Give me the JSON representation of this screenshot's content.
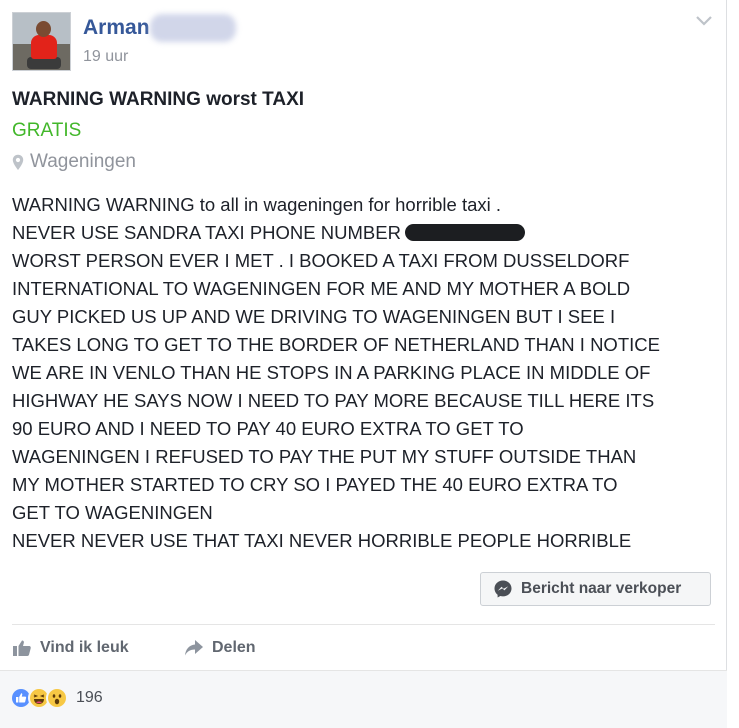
{
  "post": {
    "author": "Arman",
    "timestamp": "19 uur",
    "title": "WARNING WARNING worst TAXI",
    "price": "GRATIS",
    "location": "Wageningen",
    "description_lines": [
      "WARNING WARNING to all in wageningen for horrible taxi .",
      "NEVER USE SANDRA TAXI PHONE NUMBER",
      "WORST PERSON EVER I MET . I BOOKED A TAXI FROM DUSSELDORF",
      "INTERNATIONAL TO WAGENINGEN FOR ME AND MY MOTHER A BOLD",
      "GUY PICKED US UP AND WE DRIVING TO WAGENINGEN BUT I SEE I",
      "TAKES LONG TO GET TO THE BORDER OF NETHERLAND THAN I NOTICE",
      "WE ARE IN VENLO THAN HE STOPS IN A PARKING PLACE IN MIDDLE OF",
      "HIGHWAY HE SAYS NOW I NEED TO PAY MORE BECAUSE TILL HERE ITS",
      "90 EURO AND I NEED TO PAY 40 EURO EXTRA TO GET TO",
      "WAGENINGEN I REFUSED TO PAY THE PUT MY STUFF OUTSIDE THAN",
      "MY MOTHER STARTED TO CRY SO I PAYED THE 40 EURO EXTRA TO",
      "GET TO WAGENINGEN",
      "NEVER NEVER USE THAT TAXI NEVER HORRIBLE PEOPLE HORRIBLE"
    ]
  },
  "actions": {
    "message_seller": "Bericht naar verkoper",
    "like": "Vind ik leuk",
    "share": "Delen"
  },
  "reactions": {
    "icons": [
      "like-icon",
      "haha-icon",
      "wow-icon"
    ],
    "count": "196"
  },
  "colors": {
    "author": "#365899",
    "price": "#42b72a",
    "muted": "#90949c",
    "like_blue": "#5890ff",
    "emoji_yellow": "#f7c844"
  }
}
